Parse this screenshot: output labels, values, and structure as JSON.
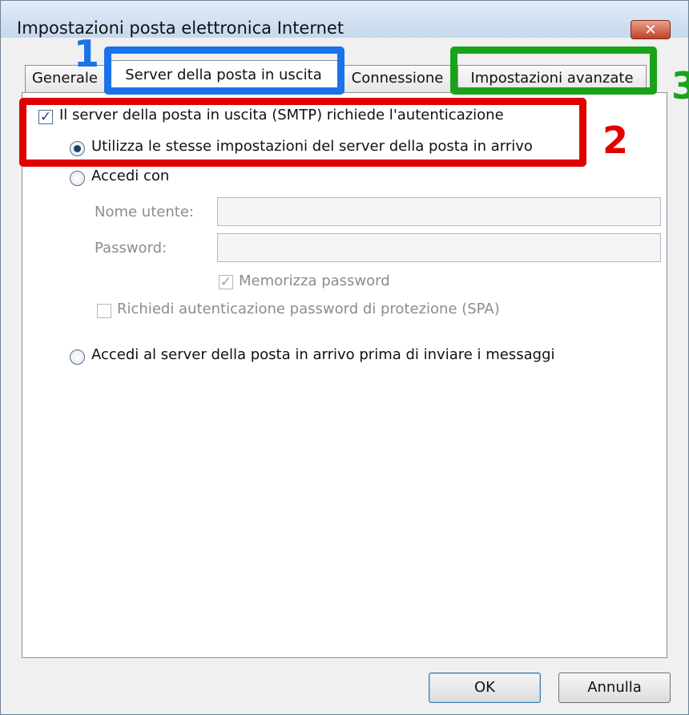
{
  "window": {
    "title": "Impostazioni posta elettronica Internet",
    "close_label": "✕"
  },
  "tabs": [
    {
      "label": "Generale",
      "active": false
    },
    {
      "label": "Server della posta in uscita",
      "active": true
    },
    {
      "label": "Connessione",
      "active": false
    },
    {
      "label": "Impostazioni avanzate",
      "active": false
    }
  ],
  "outgoing": {
    "smtp_auth_label": "Il server della posta in uscita (SMTP) richiede l'autenticazione",
    "smtp_auth_checked": true,
    "use_same_settings_label": "Utilizza le stesse impostazioni del server della posta in arrivo",
    "use_same_settings_selected": true,
    "login_with_label": "Accedi con",
    "username_label": "Nome utente:",
    "username_value": "",
    "password_label": "Password:",
    "password_value": "",
    "remember_password_label": "Memorizza password",
    "remember_password_checked": true,
    "spa_label": "Richiedi autenticazione password di protezione (SPA)",
    "spa_checked": false,
    "login_incoming_first_label": "Accedi al server della posta in arrivo prima di inviare i messaggi"
  },
  "buttons": {
    "ok": "OK",
    "cancel": "Annulla"
  },
  "annotations": [
    {
      "label": "1",
      "color": "#1a73e8"
    },
    {
      "label": "2",
      "color": "#e00000"
    },
    {
      "label": "3",
      "color": "#1aa31a"
    }
  ],
  "colors": {
    "highlight_blue": "#1a73e8",
    "highlight_red": "#e00000",
    "highlight_green": "#1aa31a"
  },
  "icons": {
    "checkbox_checked": "✓",
    "close": "close-icon"
  }
}
